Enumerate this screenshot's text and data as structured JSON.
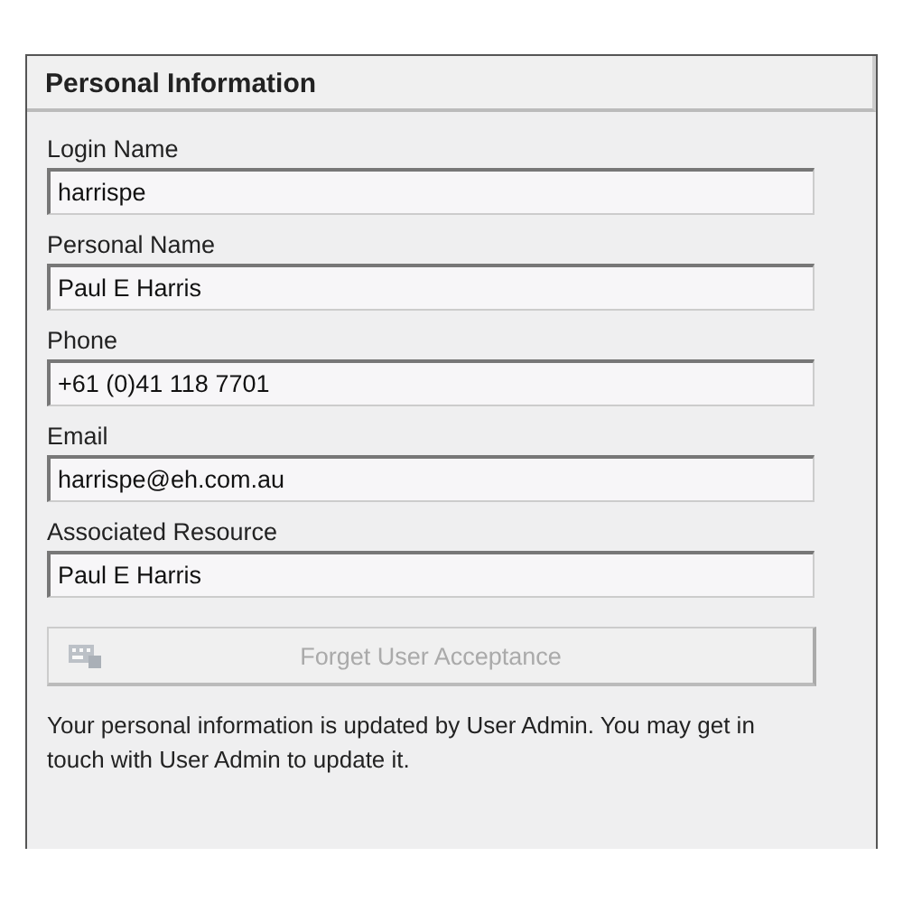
{
  "panel": {
    "title": "Personal Information"
  },
  "fields": [
    {
      "label": "Login Name",
      "value": "harrispe"
    },
    {
      "label": "Personal Name",
      "value": "Paul E Harris"
    },
    {
      "label": "Phone",
      "value": "+61 (0)41 118 7701"
    },
    {
      "label": "Email",
      "value": "harrispe@eh.com.au"
    },
    {
      "label": "Associated Resource",
      "value": "Paul E Harris"
    }
  ],
  "button": {
    "label": "Forget User Acceptance",
    "disabled": true
  },
  "note": "Your personal information is updated by User Admin. You may get in touch with User Admin to update it."
}
